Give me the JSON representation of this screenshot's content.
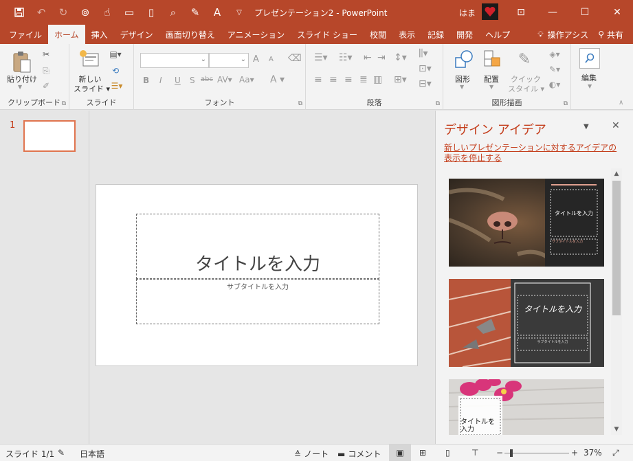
{
  "titlebar": {
    "doc_title": "プレゼンテーション2  -  PowerPoint",
    "user": "はま",
    "qat": [
      "save-icon",
      "undo-icon",
      "redo-icon",
      "presenter-icon",
      "touch-icon",
      "open-icon",
      "new-icon",
      "print-preview-icon",
      "format-painter-icon",
      "font-color-icon",
      "customize-icon"
    ]
  },
  "tabs": {
    "items": [
      "ファイル",
      "ホーム",
      "挿入",
      "デザイン",
      "画面切り替え",
      "アニメーション",
      "スライド ショー",
      "校閲",
      "表示",
      "記録",
      "開発",
      "ヘルプ"
    ],
    "active": "ホーム",
    "tell_me": "操作アシス",
    "share": "共有"
  },
  "ribbon": {
    "clipboard": {
      "paste": "貼り付け",
      "label": "クリップボード"
    },
    "slides": {
      "new_slide_1": "新しい",
      "new_slide_2": "スライド",
      "label": "スライド"
    },
    "font": {
      "label": "フォント",
      "bold": "B",
      "italic": "I",
      "underline": "U",
      "strike": "S",
      "shadow": "abc",
      "spacing": "AV",
      "case": "Aa",
      "color": "A",
      "grow": "A",
      "shrink": "A"
    },
    "paragraph": {
      "label": "段落"
    },
    "drawing": {
      "shapes": "図形",
      "arrange": "配置",
      "quick1": "クイック",
      "quick2": "スタイル",
      "label": "図形描画"
    },
    "editing": {
      "label": "編集"
    }
  },
  "thumbnails": {
    "number": "1"
  },
  "slide": {
    "title_placeholder": "タイトルを入力",
    "subtitle_placeholder": "サブタイトルを入力"
  },
  "design_pane": {
    "title": "デザイン アイデア",
    "link": "新しいプレゼンテーションに対するアイデアの表示を停止する",
    "cards": [
      {
        "title": "タイトルを入力",
        "subtitle": "サブタイトルを入力"
      },
      {
        "title": "タイトルを入力",
        "subtitle": "サブタイトルを入力"
      },
      {
        "title": "タイトルを入力"
      }
    ]
  },
  "statusbar": {
    "slide_count": "スライド 1/1",
    "language": "日本語",
    "notes": "ノート",
    "comments": "コメント",
    "zoom": "37%"
  },
  "colors": {
    "accent": "#b7472a",
    "accent_text": "#c43e1c"
  }
}
